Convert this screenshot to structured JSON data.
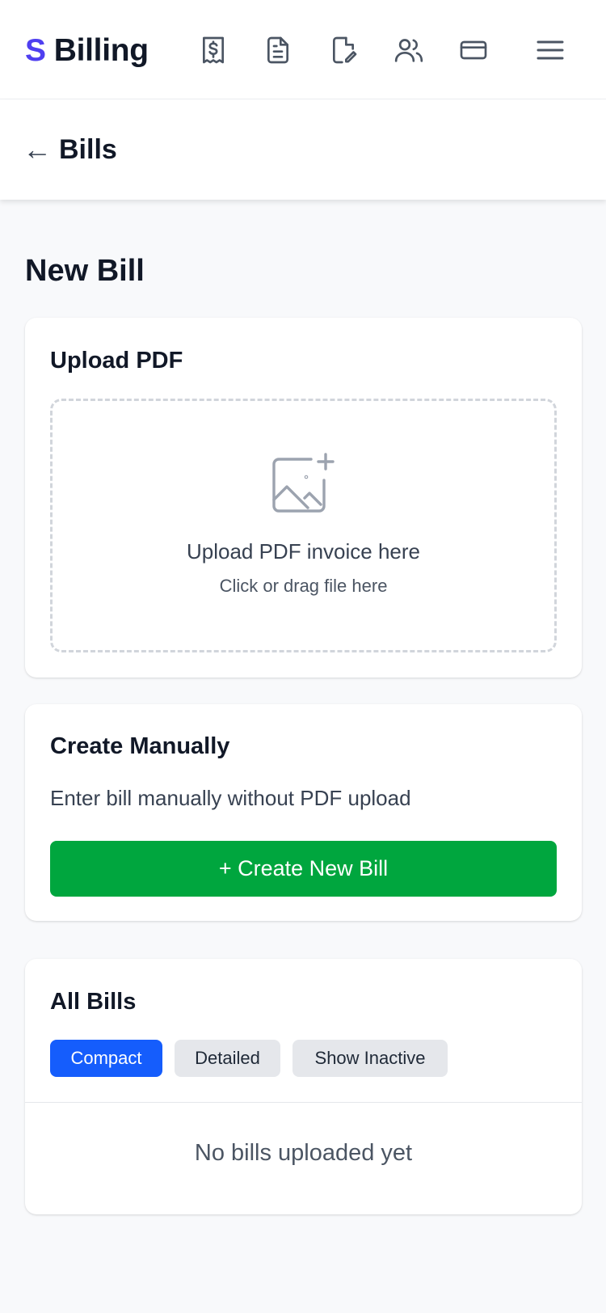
{
  "header": {
    "brand_letter": "S",
    "brand_name": "Billing",
    "nav_icons": [
      "receipt-dollar-icon",
      "document-icon",
      "edit-document-icon",
      "users-icon",
      "credit-card-icon",
      "menu-icon"
    ]
  },
  "subheader": {
    "back_arrow": "←",
    "title": "Bills"
  },
  "page": {
    "title": "New Bill"
  },
  "upload": {
    "title": "Upload PDF",
    "main_text": "Upload PDF invoice here",
    "sub_text": "Click or drag file here"
  },
  "manual": {
    "title": "Create Manually",
    "description": "Enter bill manually without PDF upload",
    "button_label": "+ Create New Bill"
  },
  "bills": {
    "title": "All Bills",
    "toggles": [
      {
        "label": "Compact",
        "active": true
      },
      {
        "label": "Detailed",
        "active": false
      },
      {
        "label": "Show Inactive",
        "active": false
      }
    ],
    "empty_text": "No bills uploaded yet"
  },
  "colors": {
    "brand_accent": "#4f3ff0",
    "primary_green": "#00a63e",
    "primary_blue": "#155dfc",
    "icon_gray": "#4b5563"
  }
}
